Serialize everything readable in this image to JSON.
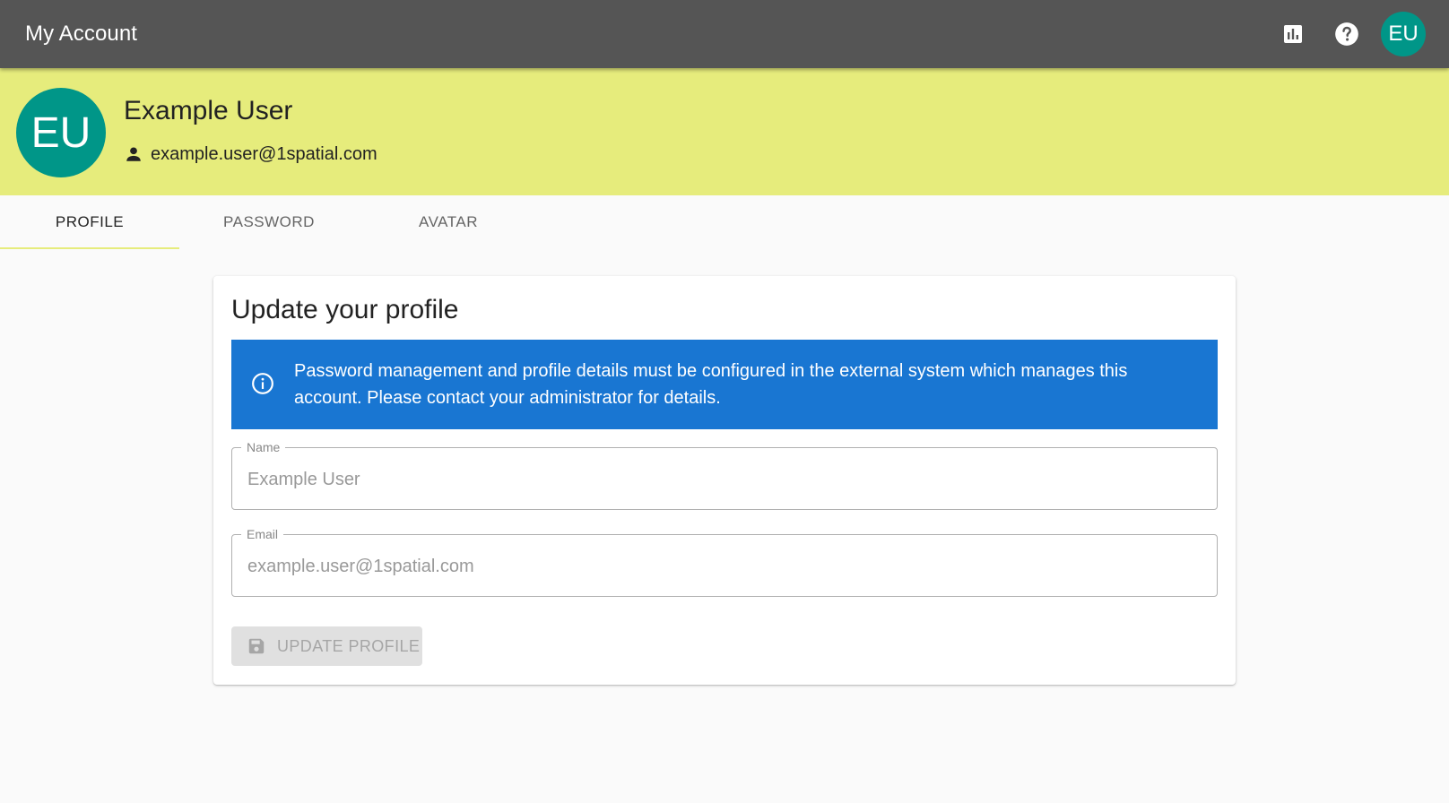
{
  "appbar": {
    "title": "My Account",
    "icons": [
      "bar-chart-icon",
      "help-icon"
    ],
    "avatar_initials": "EU"
  },
  "banner": {
    "avatar_initials": "EU",
    "name": "Example User",
    "email": "example.user@1spatial.com",
    "background": "#e6ec7c",
    "avatar_color": "#009688"
  },
  "tabs": [
    {
      "label": "PROFILE",
      "active": true
    },
    {
      "label": "PASSWORD",
      "active": false
    },
    {
      "label": "AVATAR",
      "active": false
    }
  ],
  "profile": {
    "title": "Update your profile",
    "info_message": "Password management and profile details must be configured in the external system which manages this account. Please contact your administrator for details.",
    "info_color": "#1976d2",
    "fields": [
      {
        "label": "Name",
        "value": "Example User"
      },
      {
        "label": "Email",
        "value": "example.user@1spatial.com"
      }
    ],
    "update_button": "UPDATE PROFILE",
    "update_button_disabled": true
  }
}
